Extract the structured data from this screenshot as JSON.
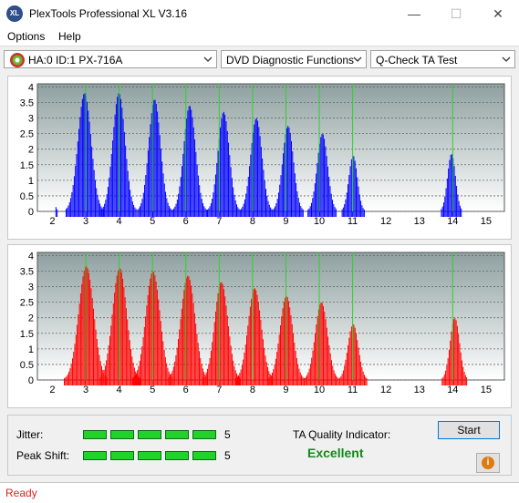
{
  "window": {
    "icon_text": "XL",
    "title": "PlexTools Professional XL V3.16",
    "minimize": "—",
    "maximize": "☐",
    "close": "✕"
  },
  "menu": {
    "items": [
      "Options",
      "Help"
    ]
  },
  "toolbar": {
    "drive": "HA:0 ID:1  PX-716A",
    "function": "DVD Diagnostic Functions",
    "test": "Q-Check TA Test"
  },
  "chart_data": [
    {
      "type": "bar",
      "name": "top-panel",
      "color": "#0000ff",
      "x_ticks": [
        "2",
        "3",
        "4",
        "5",
        "6",
        "7",
        "8",
        "9",
        "10",
        "11",
        "12",
        "13",
        "14",
        "15"
      ],
      "y_ticks": [
        "0",
        "0.5",
        "1",
        "1.5",
        "2",
        "2.5",
        "3",
        "3.5",
        "4"
      ],
      "xlim": [
        1.55,
        15.55
      ],
      "ylim": [
        0,
        4.1
      ],
      "peaks": [
        {
          "x": 2.1,
          "h": 0.15,
          "w": 0.03
        },
        {
          "x": 2.95,
          "h": 3.8,
          "w": 0.28
        },
        {
          "x": 3.98,
          "h": 3.8,
          "w": 0.26
        },
        {
          "x": 5.05,
          "h": 3.6,
          "w": 0.25
        },
        {
          "x": 6.1,
          "h": 3.4,
          "w": 0.25
        },
        {
          "x": 7.12,
          "h": 3.2,
          "w": 0.24
        },
        {
          "x": 8.1,
          "h": 3.0,
          "w": 0.24
        },
        {
          "x": 9.05,
          "h": 2.75,
          "w": 0.23
        },
        {
          "x": 10.08,
          "h": 2.5,
          "w": 0.22
        },
        {
          "x": 11.0,
          "h": 1.8,
          "w": 0.18
        },
        {
          "x": 13.95,
          "h": 1.85,
          "w": 0.17
        }
      ],
      "green_lines": [
        3,
        4,
        5,
        6,
        7,
        8,
        9,
        10,
        11,
        14
      ]
    },
    {
      "type": "bar",
      "name": "bottom-panel",
      "color": "#ff0000",
      "x_ticks": [
        "2",
        "3",
        "4",
        "5",
        "6",
        "7",
        "8",
        "9",
        "10",
        "11",
        "12",
        "13",
        "14",
        "15"
      ],
      "y_ticks": [
        "0",
        "0.5",
        "1",
        "1.5",
        "2",
        "2.5",
        "3",
        "3.5",
        "4"
      ],
      "xlim": [
        1.55,
        15.55
      ],
      "ylim": [
        0,
        4.1
      ],
      "peaks": [
        {
          "x": 3.0,
          "h": 3.65,
          "w": 0.32
        },
        {
          "x": 4.0,
          "h": 3.6,
          "w": 0.3
        },
        {
          "x": 5.0,
          "h": 3.5,
          "w": 0.3
        },
        {
          "x": 6.05,
          "h": 3.35,
          "w": 0.3
        },
        {
          "x": 7.05,
          "h": 3.15,
          "w": 0.28
        },
        {
          "x": 8.05,
          "h": 2.95,
          "w": 0.28
        },
        {
          "x": 9.0,
          "h": 2.7,
          "w": 0.27
        },
        {
          "x": 10.05,
          "h": 2.5,
          "w": 0.26
        },
        {
          "x": 11.0,
          "h": 1.8,
          "w": 0.22
        },
        {
          "x": 14.05,
          "h": 2.0,
          "w": 0.2
        }
      ],
      "green_lines": [
        3,
        4,
        5,
        6,
        7,
        8,
        9,
        10,
        11,
        14
      ]
    }
  ],
  "results": {
    "jitter_label": "Jitter:",
    "jitter_value": "5",
    "jitter_segments": 5,
    "peak_shift_label": "Peak Shift:",
    "peak_shift_value": "5",
    "peak_shift_segments": 5,
    "ta_label": "TA Quality Indicator:",
    "ta_value": "Excellent",
    "start_label": "Start",
    "info_icon": "i"
  },
  "status": {
    "text": "Ready"
  }
}
